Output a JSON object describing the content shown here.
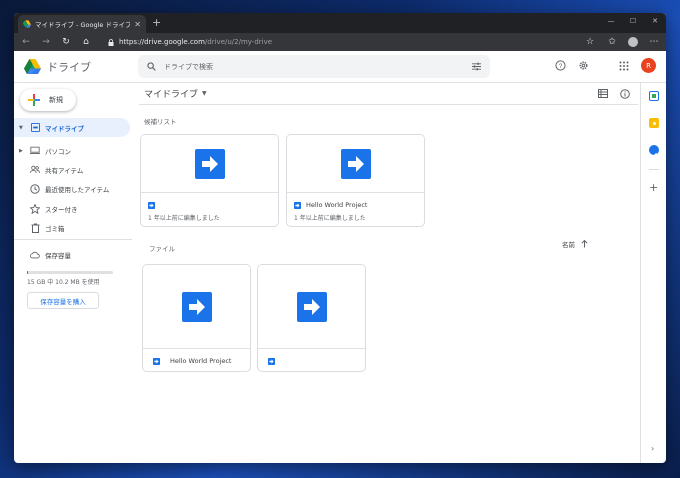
{
  "browser": {
    "tab_title": "マイドライブ - Google ドライブ",
    "url_host": "https://drive.google.com",
    "url_path": "/drive/u/2/my-drive"
  },
  "header": {
    "logo_text": "ドライブ",
    "search_placeholder": "ドライブで検索",
    "avatar_letter": "R"
  },
  "sidebar": {
    "new_label": "新規",
    "items": [
      {
        "label": "マイドライブ",
        "icon": "drive-folder-icon"
      },
      {
        "label": "パソコン",
        "icon": "computer-icon"
      },
      {
        "label": "共有アイテム",
        "icon": "shared-people-icon"
      },
      {
        "label": "最近使用したアイテム",
        "icon": "clock-icon"
      },
      {
        "label": "スター付き",
        "icon": "star-icon"
      },
      {
        "label": "ゴミ箱",
        "icon": "trash-icon"
      }
    ],
    "storage_label": "保存容量",
    "storage_usage": "15 GB 中 10.2 MB を使用",
    "storage_fraction": 0.0007,
    "buy_storage_label": "保存容量を購入"
  },
  "main": {
    "title": "マイドライブ",
    "suggested_label": "候補リスト",
    "suggested": [
      {
        "name": "",
        "subtitle": "1 年以上前に編集しました"
      },
      {
        "name": "Hello World Project",
        "subtitle": "1 年以上前に編集しました"
      }
    ],
    "files_label": "ファイル",
    "sort_label": "名前",
    "files": [
      {
        "name": "Hello World Project"
      },
      {
        "name": ""
      }
    ]
  },
  "colors": {
    "accent": "#1a73e8",
    "script_icon": "#1a73e8",
    "avatar": "#e8431e"
  }
}
